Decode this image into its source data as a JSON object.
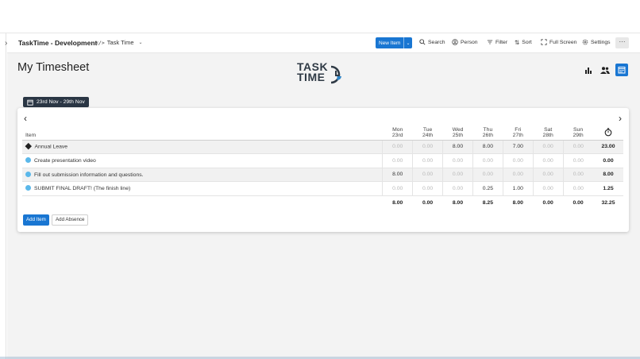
{
  "app": {
    "title": "TaskTime - Development",
    "view_label": "Task Time",
    "view_icon": "code-icon"
  },
  "toolbar": {
    "new_item": "New Item",
    "search": "Search",
    "person": "Person",
    "filter": "Filter",
    "sort": "Sort",
    "fullscreen": "Full Screen",
    "settings": "Settings",
    "more": "···"
  },
  "page": {
    "title": "My Timesheet",
    "logo_line1": "TASK",
    "logo_line2": "TIME",
    "date_range": "23rd Nov - 29th Nov"
  },
  "header_icons": [
    "bar-chart-icon",
    "people-icon",
    "calendar-icon"
  ],
  "timesheet": {
    "item_header": "Item",
    "days": [
      {
        "day": "Mon",
        "date": "23rd"
      },
      {
        "day": "Tue",
        "date": "24th"
      },
      {
        "day": "Wed",
        "date": "25th"
      },
      {
        "day": "Thu",
        "date": "26th"
      },
      {
        "day": "Fri",
        "date": "27th"
      },
      {
        "day": "Sat",
        "date": "28th"
      },
      {
        "day": "Sun",
        "date": "29th"
      }
    ],
    "total_icon": "stopwatch-icon",
    "rows": [
      {
        "name": "Annual Leave",
        "marker": "diamond",
        "values": [
          "0.00",
          "0.00",
          "8.00",
          "8.00",
          "7.00",
          "0.00",
          "0.00"
        ],
        "total": "23.00"
      },
      {
        "name": "Create presentation video",
        "marker": "dot",
        "values": [
          "0.00",
          "0.00",
          "0.00",
          "0.00",
          "0.00",
          "0.00",
          "0.00"
        ],
        "total": "0.00"
      },
      {
        "name": "Fill out submission information and questions.",
        "marker": "dot",
        "values": [
          "8.00",
          "0.00",
          "0.00",
          "0.00",
          "0.00",
          "0.00",
          "0.00"
        ],
        "total": "8.00"
      },
      {
        "name": "SUBMIT FINAL DRAFT! (The finish line)",
        "marker": "dot",
        "values": [
          "0.00",
          "0.00",
          "0.00",
          "0.25",
          "1.00",
          "0.00",
          "0.00"
        ],
        "total": "1.25"
      }
    ],
    "footer": {
      "values": [
        "8.00",
        "0.00",
        "8.00",
        "8.25",
        "8.00",
        "0.00",
        "0.00"
      ],
      "total": "32.25"
    }
  },
  "buttons": {
    "add_item": "Add Item",
    "add_absence": "Add Absence"
  },
  "colors": {
    "primary": "#1976d2",
    "dark_chip": "#2a3644",
    "bullet": "#5bb8ea"
  }
}
